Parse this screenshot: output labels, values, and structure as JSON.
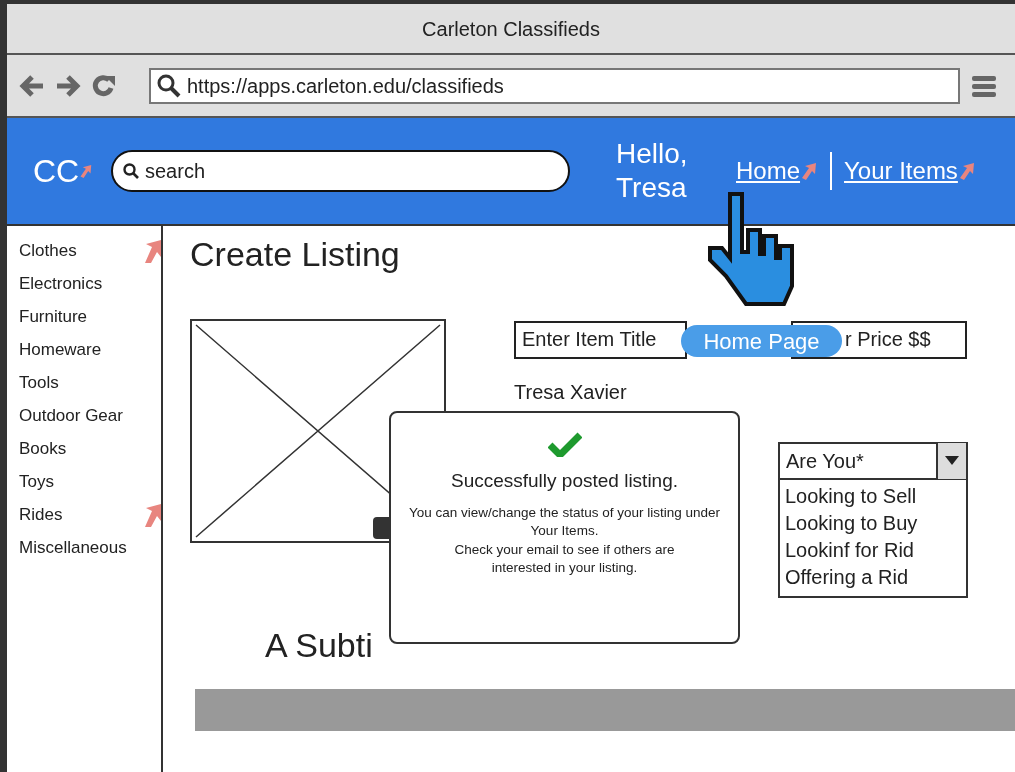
{
  "window": {
    "title": "Carleton Classifieds"
  },
  "browser": {
    "url": "https://apps.carleton.edu/classifieds"
  },
  "header": {
    "logo": "CC",
    "search": {
      "placeholder": "search"
    },
    "greeting": "Hello, Tresa",
    "nav": [
      {
        "label": "Home",
        "linked": true
      },
      {
        "label": "Your Items",
        "linked": true
      }
    ]
  },
  "sidebar": {
    "items": [
      {
        "label": "Clothes",
        "linked": true
      },
      {
        "label": "Electronics",
        "linked": false
      },
      {
        "label": "Furniture",
        "linked": false
      },
      {
        "label": "Homeware",
        "linked": false
      },
      {
        "label": "Tools",
        "linked": false
      },
      {
        "label": "Outdoor Gear",
        "linked": false
      },
      {
        "label": "Books",
        "linked": false
      },
      {
        "label": "Toys",
        "linked": false
      },
      {
        "label": "Rides",
        "linked": true
      },
      {
        "label": "Miscellaneous",
        "linked": false
      }
    ]
  },
  "form": {
    "heading": "Create Listing",
    "title_field": {
      "placeholder": "Enter Item Title"
    },
    "price_field": {
      "placeholder": "r Price $$"
    },
    "seller": "Tresa Xavier",
    "dropdown": {
      "label": "Are You*",
      "expanded": true,
      "options": [
        "Looking to Sell",
        "Looking to Buy",
        "Lookinf for Rid",
        "Offering a Rid"
      ]
    },
    "subtitle": "A Subti"
  },
  "tooltip": "Home Page",
  "dialog": {
    "title": "Successfully posted listing.",
    "message": [
      "You can view/change the status of your listing under Your Items.",
      "Check your email to see if others are interested in your listing."
    ]
  }
}
